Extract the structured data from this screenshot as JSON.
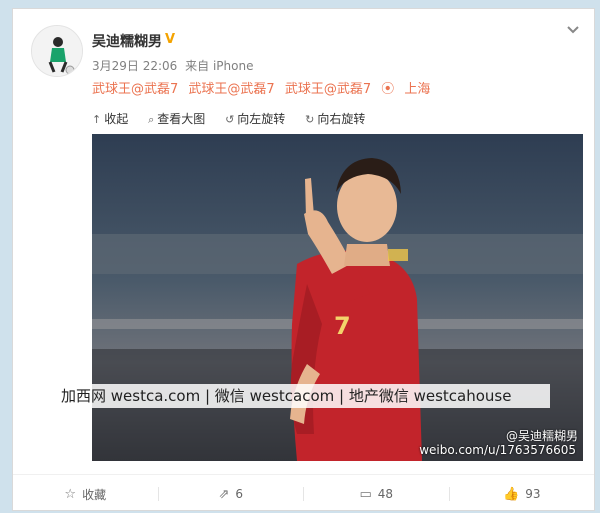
{
  "post": {
    "username": "吴迪糯糊男",
    "verified_badge": "V",
    "timestamp": "3月29日 22:06",
    "source": "来自 iPhone",
    "text_tags": [
      "武球王@武磊7",
      "武球王@武磊7",
      "武球王@武磊7"
    ],
    "location": "上海"
  },
  "toolbar": {
    "collapse": "收起",
    "view_large": "查看大图",
    "rotate_left": "向左旋转",
    "rotate_right": "向右旋转"
  },
  "photo": {
    "overlay_text": "加西网 westca.com | 微信 westcacom | 地产微信 westcahouse",
    "credit_line1": "@吴迪糯糊男",
    "credit_line2": "weibo.com/u/1763576605"
  },
  "actions": {
    "favorite": "收藏",
    "repost_count": "6",
    "comment_count": "48",
    "like_count": "93"
  },
  "icons": {
    "chevron": "chevron-down-icon",
    "location": "location-pin-icon"
  },
  "colors": {
    "accent": "#eb7350",
    "verified": "#f4a300",
    "background": "#cfe1ec"
  }
}
